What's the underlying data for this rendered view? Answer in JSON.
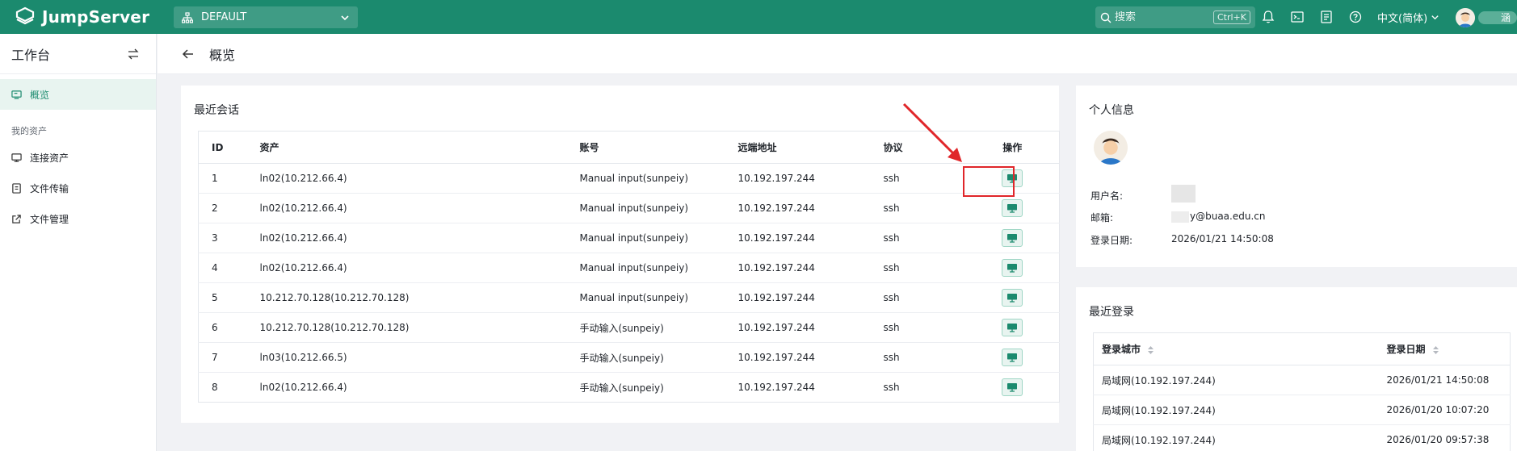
{
  "topbar": {
    "logo_text": "JumpServer",
    "org": "DEFAULT",
    "search_placeholder": "搜索",
    "search_shortcut": "Ctrl+K",
    "language": "中文(简体)",
    "user_name_partial": "涵"
  },
  "sidebar": {
    "title": "工作台",
    "overview": "概览",
    "group_label": "我的资产",
    "items": [
      {
        "label": "连接资产",
        "icon": "monitor-icon"
      },
      {
        "label": "文件传输",
        "icon": "file-transfer-icon"
      },
      {
        "label": "文件管理",
        "icon": "external-link-icon"
      }
    ]
  },
  "page": {
    "title": "概览"
  },
  "sessions": {
    "title": "最近会话",
    "columns": [
      "ID",
      "资产",
      "账号",
      "远端地址",
      "协议",
      "操作"
    ],
    "rows": [
      {
        "id": "1",
        "asset": "ln02(10.212.66.4)",
        "account": "Manual input(sunpeiy)",
        "remote": "10.192.197.244",
        "protocol": "ssh"
      },
      {
        "id": "2",
        "asset": "ln02(10.212.66.4)",
        "account": "Manual input(sunpeiy)",
        "remote": "10.192.197.244",
        "protocol": "ssh"
      },
      {
        "id": "3",
        "asset": "ln02(10.212.66.4)",
        "account": "Manual input(sunpeiy)",
        "remote": "10.192.197.244",
        "protocol": "ssh"
      },
      {
        "id": "4",
        "asset": "ln02(10.212.66.4)",
        "account": "Manual input(sunpeiy)",
        "remote": "10.192.197.244",
        "protocol": "ssh"
      },
      {
        "id": "5",
        "asset": "10.212.70.128(10.212.70.128)",
        "account": "Manual input(sunpeiy)",
        "remote": "10.192.197.244",
        "protocol": "ssh"
      },
      {
        "id": "6",
        "asset": "10.212.70.128(10.212.70.128)",
        "account": "手动输入(sunpeiy)",
        "remote": "10.192.197.244",
        "protocol": "ssh"
      },
      {
        "id": "7",
        "asset": "ln03(10.212.66.5)",
        "account": "手动输入(sunpeiy)",
        "remote": "10.192.197.244",
        "protocol": "ssh"
      },
      {
        "id": "8",
        "asset": "ln02(10.212.66.4)",
        "account": "手动输入(sunpeiy)",
        "remote": "10.192.197.244",
        "protocol": "ssh"
      }
    ]
  },
  "profile": {
    "title": "个人信息",
    "username_label": "用户名:",
    "email_label": "邮箱:",
    "email_value": "y@buaa.edu.cn",
    "login_date_label": "登录日期:",
    "login_date_value": "2026/01/21 14:50:08"
  },
  "recent_logins": {
    "title": "最近登录",
    "columns": [
      "登录城市",
      "登录日期"
    ],
    "rows": [
      {
        "city": "局域网(10.192.197.244)",
        "date": "2026/01/21 14:50:08"
      },
      {
        "city": "局域网(10.192.197.244)",
        "date": "2026/01/20 10:07:20"
      },
      {
        "city": "局域网(10.192.197.244)",
        "date": "2026/01/20 09:57:38"
      }
    ]
  },
  "colors": {
    "brand": "#1b8a6e",
    "highlight": "#e0262a"
  }
}
